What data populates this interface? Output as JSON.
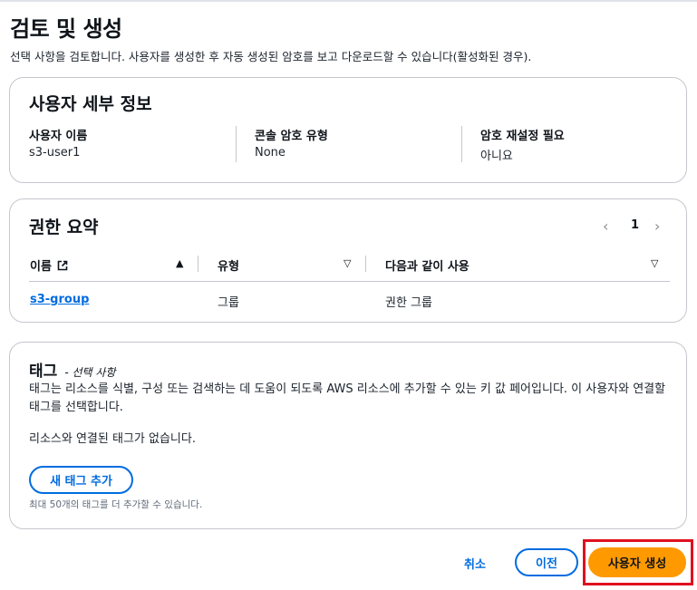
{
  "page": {
    "title": "검토 및 생성",
    "description": "선택 사항을 검토합니다. 사용자를 생성한 후 자동 생성된 암호를 보고 다운로드할 수 있습니다(활성화된 경우)."
  },
  "user_details": {
    "title": "사용자 세부 정보",
    "fields": [
      {
        "label": "사용자 이름",
        "value": "s3-user1"
      },
      {
        "label": "콘솔 암호 유형",
        "value": "None"
      },
      {
        "label": "암호 재설정 필요",
        "value": "아니요"
      }
    ]
  },
  "permissions": {
    "title": "권한 요약",
    "page_number": "1",
    "columns": [
      "이름",
      "유형",
      "다음과 같이 사용"
    ],
    "rows": [
      {
        "name": "s3-group",
        "type": "그룹",
        "used_as": "권한 그룹"
      }
    ]
  },
  "tags": {
    "title": "태그",
    "optional": "- 선택 사항",
    "description": "태그는 리소스를 식별, 구성 또는 검색하는 데 도움이 되도록 AWS 리소스에 추가할 수 있는 키 값 페어입니다. 이 사용자와 연결할 태그를 선택합니다.",
    "empty_text": "리소스와 연결된 태그가 없습니다.",
    "add_button": "새 태그 추가",
    "limit_note": "최대 50개의 태그를 더 추가할 수 있습니다."
  },
  "footer": {
    "cancel": "취소",
    "previous": "이전",
    "create": "사용자 생성"
  },
  "colors": {
    "link": "#006ce0",
    "primary": "#ff9900",
    "highlight": "#e01020"
  },
  "icons": [
    "external-link-icon",
    "sort-ascending-icon",
    "sort-descending-icon",
    "chevron-left-icon",
    "chevron-right-icon"
  ]
}
